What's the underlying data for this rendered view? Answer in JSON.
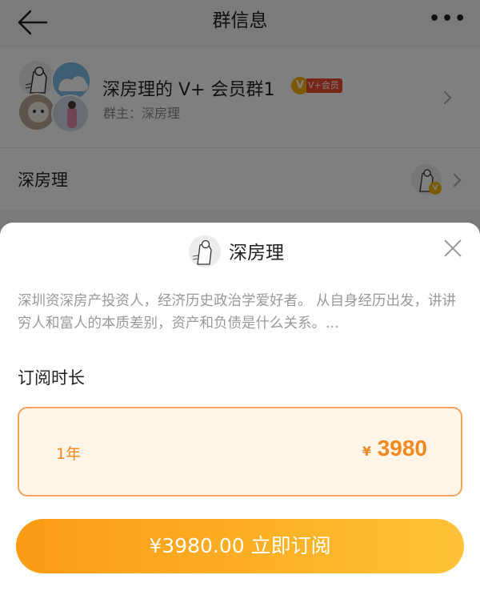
{
  "nav": {
    "title": "群信息",
    "back_icon": "arrow-left-icon",
    "more_icon": "ellipsis-icon",
    "more_glyph": "•••"
  },
  "group": {
    "name": "深房理的 V+ 会员群1",
    "badge_letter": "V",
    "badge_text": "V+会员",
    "owner_label": "群主：深房理"
  },
  "owner_row": {
    "name": "深房理",
    "vbadge": "V"
  },
  "sheet": {
    "title": "深房理",
    "description": "深圳资深房产投资人，经济历史政治学爱好者。 从自身经历出发，讲讲穷人和富人的本质差别，资产和负债是什么关系。...",
    "section_label": "订阅时长",
    "plan": {
      "duration": "1年",
      "currency": "¥",
      "price": "3980"
    },
    "subscribe_label": "¥3980.00 立即订阅"
  },
  "colors": {
    "accent": "#f08a20",
    "button_start": "#fb9a14",
    "button_end": "#ffc238",
    "plan_bg": "#fff4e8",
    "plan_border": "#f4a25b"
  }
}
